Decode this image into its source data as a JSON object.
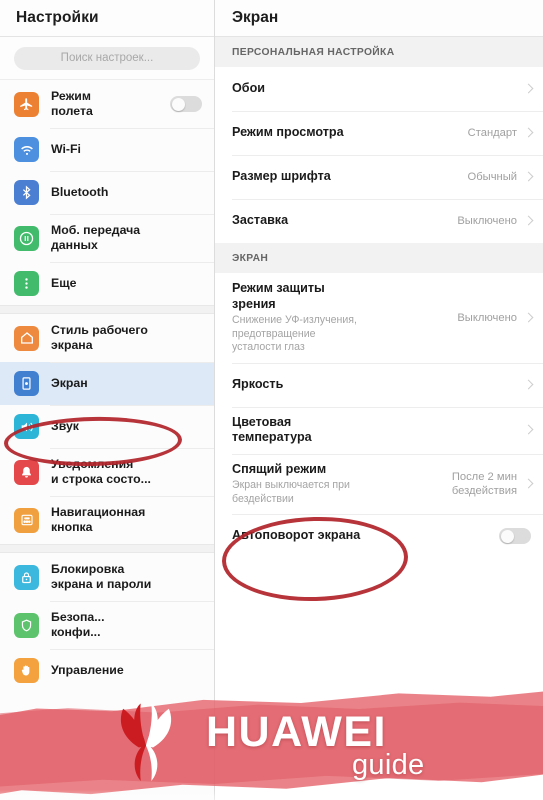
{
  "sidebar": {
    "title": "Настройки",
    "search": {
      "placeholder": "Поиск настроек..."
    },
    "groups": [
      {
        "items": [
          {
            "label": "Режим\nполета",
            "icon": "airplane-icon",
            "color": "#f08030",
            "toggle": "off"
          },
          {
            "label": "Wi-Fi",
            "icon": "wifi-icon",
            "color": "#4a90e2"
          },
          {
            "label": "Bluetooth",
            "icon": "bluetooth-icon",
            "color": "#4a7fd4"
          },
          {
            "label": "Моб. передача\nданных",
            "icon": "mobile-data-icon",
            "color": "#3fbd6b"
          },
          {
            "label": "Еще",
            "icon": "more-dots-icon",
            "color": "#3fbd6b"
          }
        ]
      },
      {
        "items": [
          {
            "label": "Стиль рабочего\nэкрана",
            "icon": "home-screen-icon",
            "color": "#f08a3c"
          },
          {
            "label": "Экран",
            "icon": "display-icon",
            "color": "#3f7fd4",
            "selected": true
          },
          {
            "label": "Звук",
            "icon": "sound-icon",
            "color": "#29b6d8"
          },
          {
            "label": "Уведомления\nи строка состо...",
            "icon": "bell-icon",
            "color": "#e8474a"
          },
          {
            "label": "Навигационная\nкнопка",
            "icon": "navigation-key-icon",
            "color": "#f2a03c"
          }
        ]
      },
      {
        "items": [
          {
            "label": "Блокировка\nэкрана и пароли",
            "icon": "lock-icon",
            "color": "#39b8e0"
          },
          {
            "label": "Безопа...\nконфи...",
            "icon": "security-icon",
            "color": "#5bc46a"
          },
          {
            "label": "Управление",
            "icon": "hand-icon",
            "color": "#f5a23c"
          }
        ]
      }
    ]
  },
  "detail": {
    "title": "Экран",
    "sections": [
      {
        "header": "ПЕРСОНАЛЬНАЯ НАСТРОЙКА",
        "rows": [
          {
            "title": "Обои",
            "value": "",
            "chevron": true
          },
          {
            "title": "Режим просмотра",
            "value": "Стандарт",
            "chevron": true
          },
          {
            "title": "Размер шрифта",
            "value": "Обычный",
            "chevron": true
          },
          {
            "title": "Заставка",
            "value": "Выключено",
            "chevron": true
          }
        ]
      },
      {
        "header": "ЭКРАН",
        "rows": [
          {
            "title": "Режим защиты\nзрения",
            "subtitle": "Снижение УФ-излучения,\nпредотвращение\nусталости глаз",
            "value": "Выключено",
            "chevron": true
          },
          {
            "title": "Яркость",
            "value": "",
            "chevron": true
          },
          {
            "title": "Цветовая\nтемпература",
            "value": "",
            "chevron": true
          },
          {
            "title": "Спящий режим",
            "subtitle": "Экран выключается при\nбездействии",
            "value": "После 2 мин\nбездействия",
            "chevron": true
          },
          {
            "title": "Автоповорот экрана",
            "value": "",
            "toggle": "off"
          }
        ]
      }
    ]
  },
  "annotations": {
    "color": "#b4232a",
    "ellipses": [
      {
        "name": "highlight-ekran-sidebar",
        "target": "Экран"
      },
      {
        "name": "highlight-sleep-mode",
        "target": "Спящий режим"
      }
    ]
  },
  "watermark": {
    "brand": "HUAWEI",
    "sub": "guide",
    "band_color": "#e8636a",
    "logo": "huawei-flower-logo"
  }
}
